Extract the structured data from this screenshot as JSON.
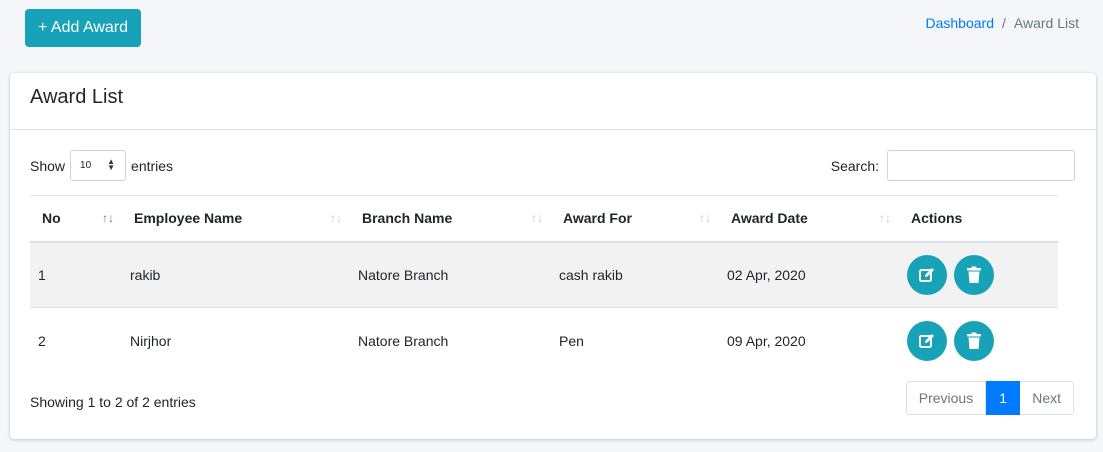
{
  "toolbar": {
    "add_label": "+ Add Award"
  },
  "breadcrumb": {
    "home": "Dashboard",
    "separator": "/",
    "current": "Award List"
  },
  "card": {
    "title": "Award List"
  },
  "length": {
    "show": "Show",
    "value": "10",
    "entries": "entries"
  },
  "search": {
    "label": "Search:",
    "value": ""
  },
  "table": {
    "headers": [
      "No",
      "Employee Name",
      "Branch Name",
      "Award For",
      "Award Date",
      "Actions"
    ],
    "rows": [
      {
        "no": "1",
        "employee": "rakib",
        "branch": "Natore Branch",
        "award_for": "cash rakib",
        "date": "02 Apr, 2020"
      },
      {
        "no": "2",
        "employee": "Nirjhor",
        "branch": "Natore Branch",
        "award_for": "Pen",
        "date": "09 Apr, 2020"
      }
    ]
  },
  "info": "Showing 1 to 2 of 2 entries",
  "pagination": {
    "previous": "Previous",
    "current": "1",
    "next": "Next"
  },
  "colors": {
    "accent": "#17a2b8",
    "link": "#007bff"
  },
  "icons": {
    "edit": "edit-icon",
    "delete": "trash-icon"
  }
}
